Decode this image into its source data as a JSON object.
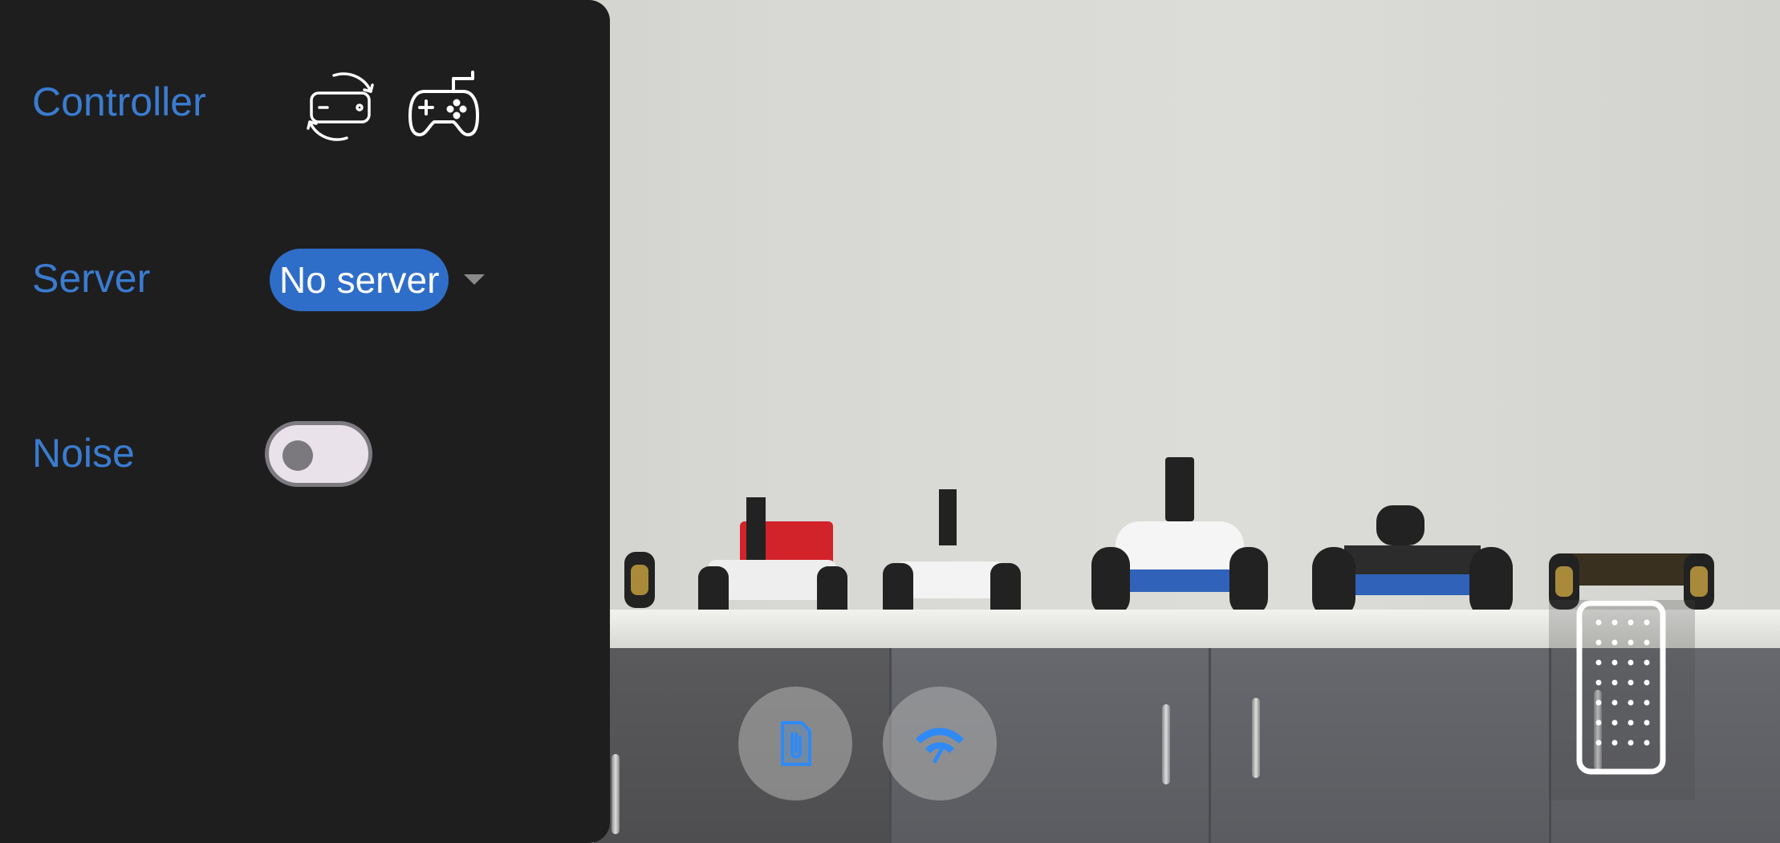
{
  "drawer": {
    "controller_label": "Controller",
    "server_label": "Server",
    "server_value": "No server",
    "noise_label": "Noise",
    "noise_enabled": false
  },
  "icons": {
    "rotate_phone": "screen-rotation-icon",
    "gamepad": "gamepad-icon",
    "logs": "document-clip-icon",
    "network": "wifi-signal-icon",
    "keypad": "remote-keypad-icon"
  },
  "colors": {
    "accent": "#3a7cd0",
    "pill": "#2f6ec8",
    "drawer_bg": "#1e1e1f",
    "icon_blue": "#2f8af5"
  }
}
